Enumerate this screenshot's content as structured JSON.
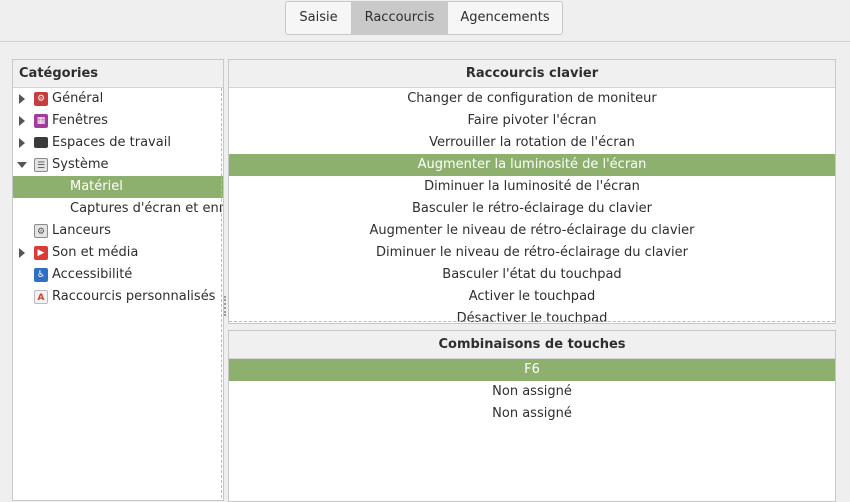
{
  "tabs": [
    {
      "label": "Saisie",
      "active": false
    },
    {
      "label": "Raccourcis",
      "active": true
    },
    {
      "label": "Agencements",
      "active": false
    }
  ],
  "categories": {
    "header": "Catégories",
    "items": [
      {
        "label": "Général",
        "icon": "general-icon",
        "expander": "collapsed",
        "selected": false,
        "sub": false
      },
      {
        "label": "Fenêtres",
        "icon": "windows-icon",
        "expander": "collapsed",
        "selected": false,
        "sub": false
      },
      {
        "label": "Espaces de travail",
        "icon": "workspace-icon",
        "expander": "collapsed",
        "selected": false,
        "sub": false
      },
      {
        "label": "Système",
        "icon": "system-icon",
        "expander": "expanded",
        "selected": false,
        "sub": false
      },
      {
        "label": "Matériel",
        "icon": "",
        "expander": "none",
        "selected": true,
        "sub": true
      },
      {
        "label": "Captures d'écran et enregistrements",
        "icon": "",
        "expander": "none",
        "selected": false,
        "sub": true
      },
      {
        "label": "Lanceurs",
        "icon": "launchers-icon",
        "expander": "none",
        "selected": false,
        "sub": false
      },
      {
        "label": "Son et média",
        "icon": "media-icon",
        "expander": "collapsed",
        "selected": false,
        "sub": false
      },
      {
        "label": "Accessibilité",
        "icon": "accessibility-icon",
        "expander": "none",
        "selected": false,
        "sub": false
      },
      {
        "label": "Raccourcis personnalisés",
        "icon": "custom-shortcuts-icon",
        "expander": "none",
        "selected": false,
        "sub": false
      }
    ]
  },
  "shortcuts": {
    "header": "Raccourcis clavier",
    "items": [
      {
        "label": "Changer de configuration de moniteur",
        "selected": false
      },
      {
        "label": "Faire pivoter l'écran",
        "selected": false
      },
      {
        "label": "Verrouiller la rotation de l'écran",
        "selected": false
      },
      {
        "label": "Augmenter la luminosité de l'écran",
        "selected": true
      },
      {
        "label": "Diminuer la luminosité de l'écran",
        "selected": false
      },
      {
        "label": "Basculer le rétro-éclairage du clavier",
        "selected": false
      },
      {
        "label": "Augmenter le niveau de rétro-éclairage du clavier",
        "selected": false
      },
      {
        "label": "Diminuer le niveau de rétro-éclairage du clavier",
        "selected": false
      },
      {
        "label": "Basculer l'état du touchpad",
        "selected": false
      },
      {
        "label": "Activer le touchpad",
        "selected": false
      },
      {
        "label": "Désactiver le touchpad",
        "selected": false
      }
    ]
  },
  "bindings": {
    "header": "Combinaisons de touches",
    "items": [
      {
        "label": "F6",
        "selected": true
      },
      {
        "label": "Non assigné",
        "selected": false
      },
      {
        "label": "Non assigné",
        "selected": false
      }
    ]
  },
  "colors": {
    "selection": "#8eb06e",
    "general": "#c83c3c",
    "windows": "#a03c9a",
    "workspace": "#3a3a3a",
    "system": "#9a9a9a",
    "media": "#d93a3a",
    "accessibility": "#2f6fc4",
    "custom": "#c8432f"
  }
}
